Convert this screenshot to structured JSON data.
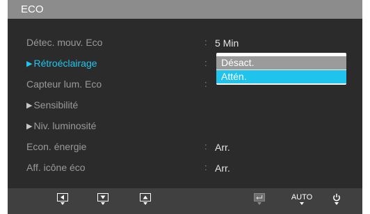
{
  "title": "ECO",
  "menu": {
    "colon": ":",
    "rows": [
      {
        "label": "Détec. mouv. Eco",
        "value": "5 Min"
      },
      {
        "label": "Rétroéclairage",
        "value": ""
      },
      {
        "label": "Capteur lum. Eco",
        "value": ""
      },
      {
        "label": "Sensibilité",
        "value": ""
      },
      {
        "label": "Niv. luminosité",
        "value": ""
      },
      {
        "label": "Econ. énergie",
        "value": "Arr."
      },
      {
        "label": "Aff. icône éco",
        "value": "Arr."
      }
    ]
  },
  "dropdown": {
    "options": [
      "Désact.",
      "Attén."
    ],
    "selected": "Attén."
  },
  "bottom_bar": {
    "auto_label": "AUTO",
    "buttons": [
      "left-arrow-icon",
      "down-arrow-icon",
      "up-arrow-icon",
      "enter-icon",
      "auto",
      "power-icon"
    ]
  },
  "colors": {
    "accent": "#21c6ee",
    "title_bar": "#8c8c8c",
    "background": "#2b2b2b",
    "label_gray": "#9a9a9a"
  }
}
